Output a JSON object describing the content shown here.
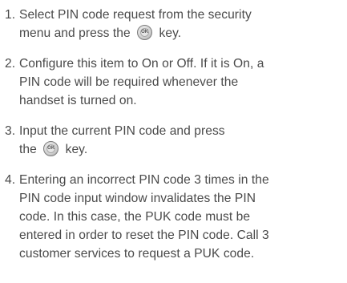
{
  "steps": [
    {
      "num": "1.",
      "lines": [
        "Select PIN code request from the security",
        "menu and press the",
        "key."
      ],
      "ok_icon_after_line": 1
    },
    {
      "num": "2.",
      "lines": [
        "Configure this item to On or Off. If it is On, a",
        "PIN code will be required whenever the",
        "handset is turned on."
      ]
    },
    {
      "num": "3.",
      "lines": [
        "Input the current PIN code and press",
        "the",
        "key."
      ],
      "ok_icon_after_line": 1
    },
    {
      "num": "4.",
      "lines": [
        "Entering an incorrect PIN code 3 times in the",
        "PIN code input window invalidates the PIN",
        "code. In this case, the PUK code must be",
        "entered in order to reset the PIN code. Call 3",
        "customer services to request a PUK code."
      ]
    }
  ],
  "ok_key_label": "OK",
  "icons": {
    "ok_key": "ok-key-icon"
  },
  "colors": {
    "text": "#4a4a4a"
  }
}
